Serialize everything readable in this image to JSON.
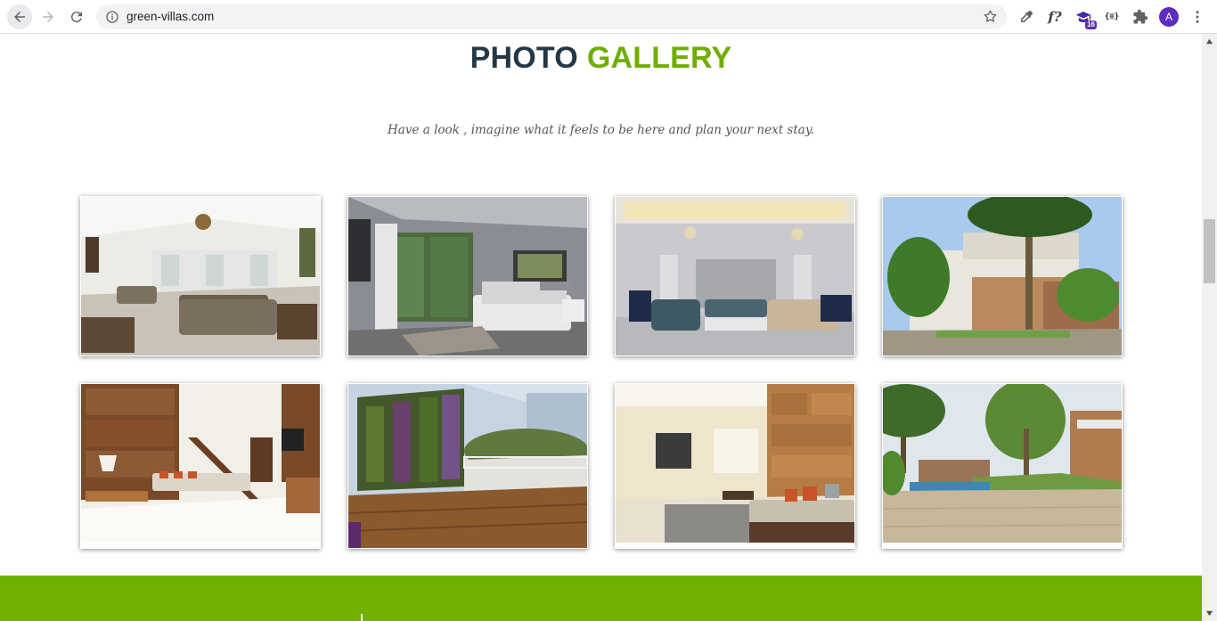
{
  "browser": {
    "url": "green-villas.com",
    "extension_badge": "16",
    "avatar_letter": "A"
  },
  "page": {
    "title_word1": "PHOTO",
    "title_word2": "GALLERY",
    "subtitle": "Have a look , imagine what it feels to be here and plan your next stay."
  },
  "gallery": [
    {
      "name": "gallery-photo-living-room-chandelier",
      "icon": "photo"
    },
    {
      "name": "gallery-photo-bedroom",
      "icon": "photo"
    },
    {
      "name": "gallery-photo-lounge",
      "icon": "photo"
    },
    {
      "name": "gallery-photo-villa-exterior-palm",
      "icon": "photo"
    },
    {
      "name": "gallery-photo-living-room-staircase",
      "icon": "photo"
    },
    {
      "name": "gallery-photo-terrace-green-wall",
      "icon": "photo"
    },
    {
      "name": "gallery-photo-living-room-sofa",
      "icon": "photo"
    },
    {
      "name": "gallery-photo-garden-pool",
      "icon": "photo"
    }
  ],
  "colors": {
    "title_dark": "#243746",
    "title_green": "#6fae00",
    "footer_green": "#70b100"
  }
}
